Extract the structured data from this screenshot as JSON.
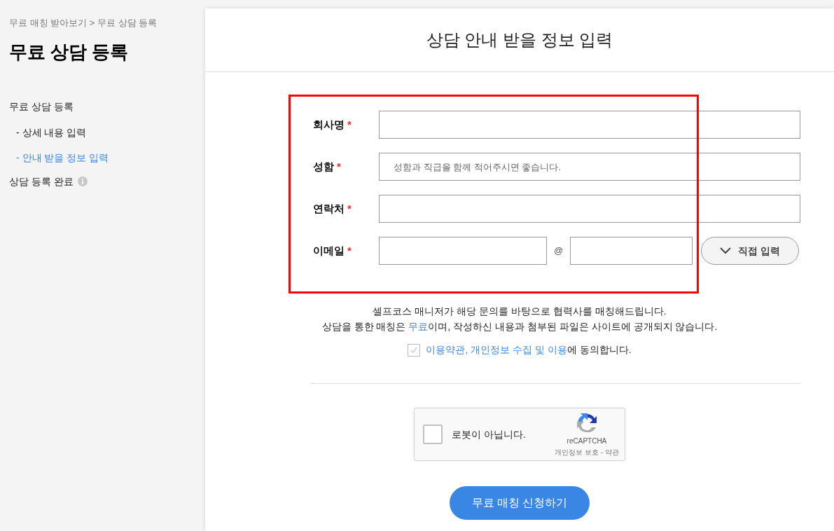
{
  "breadcrumb": "무료 매칭 받아보기 > 무료 상담 등록",
  "page_title": "무료 상담 등록",
  "sidebar": {
    "items": [
      {
        "label": "무료 상담 등록",
        "selected": false,
        "children": [
          {
            "label": "- 상세 내용 입력",
            "selected": false
          },
          {
            "label": "- 안내 받을 정보 입력",
            "selected": true
          }
        ]
      },
      {
        "label": "상담 등록 완료",
        "selected": false,
        "info_icon": true
      }
    ]
  },
  "section_title": "상담 안내 받을 정보 입력",
  "form": {
    "fields": [
      {
        "kind": "text",
        "label": "회사명",
        "required": true
      },
      {
        "kind": "text",
        "label": "성함",
        "required": true,
        "placeholder": "성함과 직급을 함께 적어주시면 좋습니다."
      },
      {
        "kind": "text",
        "label": "연락처",
        "required": true
      },
      {
        "kind": "email",
        "label": "이메일",
        "required": true,
        "at": "@",
        "domain_button": "직접 입력"
      }
    ],
    "required_mark": "*"
  },
  "notice": [
    {
      "before": "셀프코스 매니저가 해당 문의를 바탕으로 협력사를 매칭해드립니다."
    },
    {
      "before": "상담을 통한 매칭은 ",
      "highlight": "무료",
      "after": "이며, 작성하신 내용과 첨부된 파일은 사이트에 공개되지 않습니다."
    }
  ],
  "agreement": {
    "checked": false,
    "link": "이용약관, 개인정보 수집 및 이용",
    "text": "에 동의합니다."
  },
  "captcha": {
    "checked": false,
    "label": "로봇이 아닙니다.",
    "brand": "reCAPTCHA",
    "privacy": "개인정보 보호",
    "separator": "-",
    "terms": "약관"
  },
  "submit": "무료 매칭 신청하기"
}
